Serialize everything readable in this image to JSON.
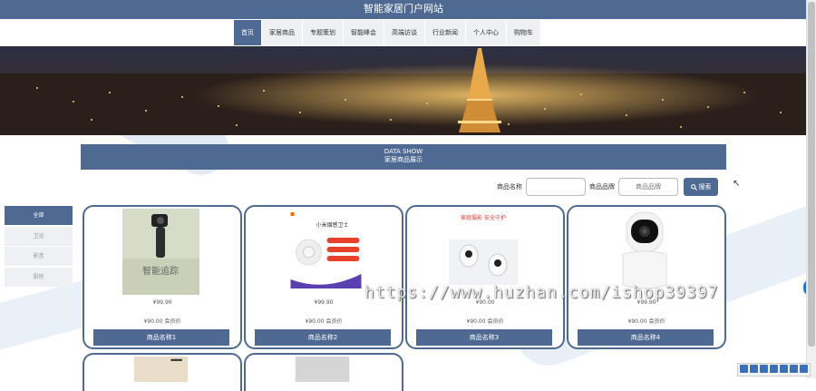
{
  "site": {
    "title": "智能家居门户网站"
  },
  "nav": [
    {
      "label": "首页",
      "active": true
    },
    {
      "label": "家居商品",
      "active": false
    },
    {
      "label": "专题策划",
      "active": false
    },
    {
      "label": "智能峰会",
      "active": false
    },
    {
      "label": "高端访谈",
      "active": false
    },
    {
      "label": "行业新闻",
      "active": false
    },
    {
      "label": "个人中心",
      "active": false
    },
    {
      "label": "购物车",
      "active": false
    }
  ],
  "section": {
    "title_en": "DATA SHOW",
    "title_cn": "家居商品展示"
  },
  "search": {
    "name_label": "商品名称",
    "name_value": "",
    "brand_label": "商品品牌",
    "brand_placeholder": "商品品牌",
    "button_label": "搜索"
  },
  "categories": [
    {
      "label": "全部",
      "active": true
    },
    {
      "label": "卫浴",
      "active": false
    },
    {
      "label": "影音",
      "active": false
    },
    {
      "label": "厨房",
      "active": false
    }
  ],
  "products": [
    {
      "name": "商品名称1",
      "price": "¥99.90",
      "original_price": "¥90.00 会员价",
      "img_text": "智能追踪",
      "theme": "gimbal"
    },
    {
      "name": "商品名称2",
      "price": "¥99.90",
      "original_price": "¥90.00 会员价",
      "img_text": "小米烟感卫士",
      "theme": "smoke"
    },
    {
      "name": "商品名称3",
      "price": "¥90.00",
      "original_price": "¥90.00 会员价",
      "img_text": "家庭摄影 安全守护",
      "theme": "camera"
    },
    {
      "name": "商品名称4",
      "price": "¥99.90",
      "original_price": "¥90.00 会员价",
      "img_text": "",
      "theme": "ptz"
    }
  ],
  "watermark": "https://www.huzhan.com/ishop39397"
}
